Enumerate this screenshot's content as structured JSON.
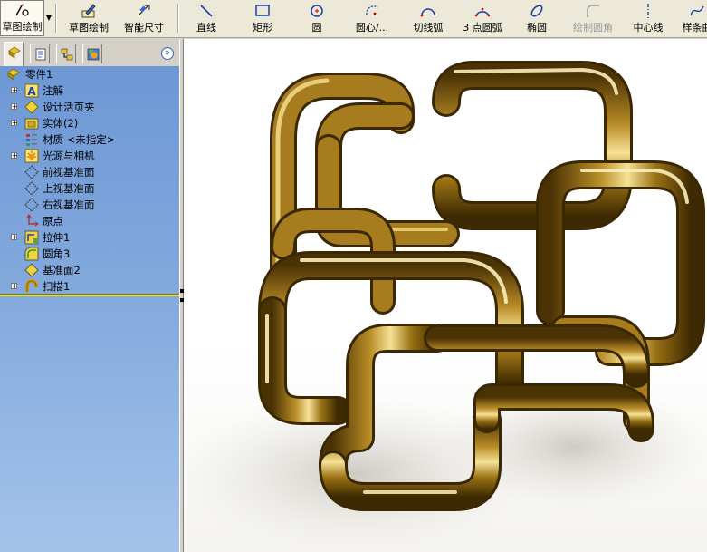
{
  "toolbar": {
    "items": [
      {
        "name": "sketch-button",
        "label": "草图绘制",
        "icon": "sketch-icon"
      },
      {
        "name": "sketch-draw-button",
        "label": "草图绘制",
        "icon": "pencil-sketch-icon"
      },
      {
        "name": "smart-dimension-button",
        "label": "智能尺寸",
        "icon": "dimension-icon"
      },
      {
        "name": "line-button",
        "label": "直线",
        "icon": "line-icon"
      },
      {
        "name": "rectangle-button",
        "label": "矩形",
        "icon": "rectangle-icon"
      },
      {
        "name": "circle-button",
        "label": "圆",
        "icon": "circle-icon"
      },
      {
        "name": "centerpoint-arc-button",
        "label": "圆心/...",
        "icon": "centerpoint-arc-icon"
      },
      {
        "name": "tangent-arc-button",
        "label": "切线弧",
        "icon": "tangent-arc-icon"
      },
      {
        "name": "three-point-arc-button",
        "label": "3 点圆弧",
        "icon": "three-point-arc-icon"
      },
      {
        "name": "ellipse-button",
        "label": "椭圆",
        "icon": "ellipse-icon"
      },
      {
        "name": "sketch-fillet-button",
        "label": "绘制圆角",
        "icon": "sketch-fillet-icon",
        "disabled": true
      },
      {
        "name": "centerline-button",
        "label": "中心线",
        "icon": "centerline-icon"
      },
      {
        "name": "spline-button",
        "label": "样条曲",
        "icon": "spline-icon"
      }
    ]
  },
  "panel": {
    "collapse_glyph": "»",
    "tabs": [
      "feature-manager-icon",
      "property-manager-icon",
      "configuration-manager-icon",
      "display-manager-icon"
    ],
    "tree": [
      {
        "label": "零件1",
        "icon": "part-icon",
        "expander": false
      },
      {
        "label": "注解",
        "icon": "annotations-icon",
        "expander": true
      },
      {
        "label": "设计活页夹",
        "icon": "design-binder-icon",
        "expander": true
      },
      {
        "label": "实体(2)",
        "icon": "solid-bodies-icon",
        "expander": true
      },
      {
        "label": "材质 <未指定>",
        "icon": "material-icon",
        "expander": false
      },
      {
        "label": "光源与相机",
        "icon": "lights-cameras-icon",
        "expander": true
      },
      {
        "label": "前视基准面",
        "icon": "plane-icon",
        "expander": false
      },
      {
        "label": "上视基准面",
        "icon": "plane-icon",
        "expander": false
      },
      {
        "label": "右视基准面",
        "icon": "plane-icon",
        "expander": false
      },
      {
        "label": "原点",
        "icon": "origin-icon",
        "expander": false
      },
      {
        "label": "拉伸1",
        "icon": "extrude-icon",
        "expander": true
      },
      {
        "label": "圆角3",
        "icon": "fillet-icon",
        "expander": false
      },
      {
        "label": "基准面2",
        "icon": "plane-feature-icon",
        "expander": false
      },
      {
        "label": "扫描1",
        "icon": "sweep-icon",
        "expander": true
      }
    ]
  },
  "colors": {
    "panel_top": "#6b96d4",
    "panel_bottom": "#a4c3eb",
    "gold_dark": "#5a3f06",
    "gold_mid": "#a67c1f",
    "gold_light": "#f4dc8a"
  }
}
